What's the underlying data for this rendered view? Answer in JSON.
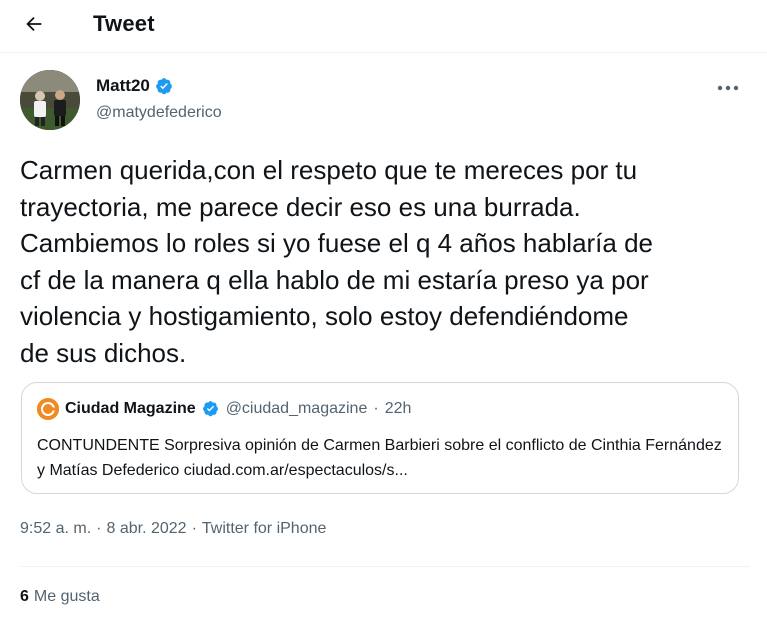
{
  "header": {
    "title": "Tweet",
    "back_icon": "arrow-left-icon"
  },
  "author": {
    "name": "Matt20",
    "handle": "@matydefederico",
    "verified": true,
    "verified_color": "#1d9bf0"
  },
  "tweet": {
    "text": "Carmen querida,con el respeto que te mereces por tu\ntrayectoria, me parece decir eso es una burrada.\nCambiemos lo roles si yo fuese el q 4 años hablaría de\ncf de la manera q ella hablo de mi estaría preso ya por\nviolencia y hostigamiento, solo estoy defendiéndome\nde sus dichos."
  },
  "quote": {
    "name": "Ciudad Magazine",
    "handle": "@ciudad_magazine",
    "separator": "·",
    "time": "22h",
    "text": "CONTUNDENTE Sorpresiva opinión de Carmen Barbieri sobre el conflicto de Cinthia Fernández y Matías Defederico ciudad.com.ar/espectaculos/s...",
    "avatar_color": "#f08a24"
  },
  "meta": {
    "time": "9:52 a. m.",
    "separator": "·",
    "date": "8 abr. 2022",
    "source": "Twitter for iPhone"
  },
  "likes": {
    "count": "6",
    "label": "Me gusta"
  },
  "colors": {
    "text_primary": "#0f1419",
    "text_secondary": "#536471",
    "accent": "#1d9bf0",
    "border": "#cfd9de"
  }
}
